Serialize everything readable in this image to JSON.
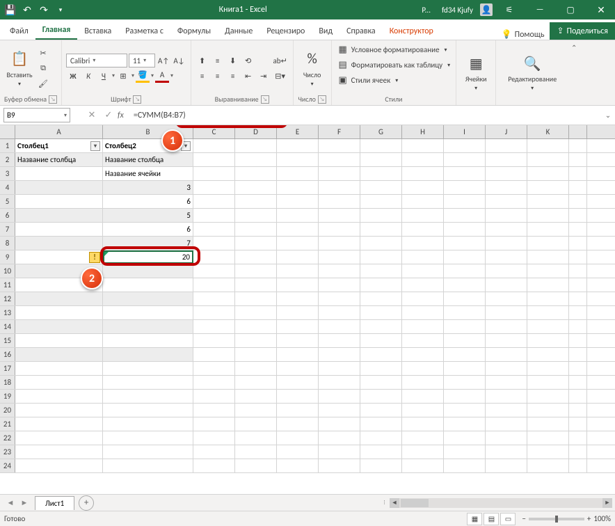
{
  "titlebar": {
    "title": "Книга1 - Excel",
    "user_initial": "P...",
    "user_name": "fd34 Kjufy"
  },
  "tabs": {
    "file": "Файл",
    "home": "Главная",
    "insert": "Вставка",
    "layout": "Разметка с",
    "formulas": "Формулы",
    "data": "Данные",
    "review": "Рецензиро",
    "view": "Вид",
    "help": "Справка",
    "constructor": "Конструктор",
    "help_btn": "Помощь",
    "share": "Поделиться"
  },
  "ribbon": {
    "clipboard": {
      "paste": "Вставить",
      "label": "Буфер обмена"
    },
    "font": {
      "name": "Calibri",
      "size": "11",
      "label": "Шрифт"
    },
    "align": {
      "label": "Выравнивание"
    },
    "number": {
      "btn": "Число",
      "label": "Число"
    },
    "styles": {
      "cond": "Условное форматирование",
      "table": "Форматировать как таблицу",
      "cell": "Стили ячеек",
      "label": "Стили"
    },
    "cells": {
      "btn": "Ячейки"
    },
    "editing": {
      "btn": "Редактирование"
    }
  },
  "namebox": "B9",
  "formula": "=СУММ(B4:B7)",
  "columns": [
    "A",
    "B",
    "C",
    "D",
    "E",
    "F",
    "G",
    "H",
    "I",
    "J",
    "K"
  ],
  "grid": {
    "a1": "Столбец1",
    "b1": "Столбец2",
    "a2": "Название столбца",
    "b2": "Название столбца",
    "b3": "Название ячейки",
    "b4": "3",
    "b5": "6",
    "b6": "5",
    "b7": "6",
    "b8": "7",
    "b9": "20"
  },
  "sheet": {
    "name": "Лист1"
  },
  "status": {
    "ready": "Готово",
    "zoom": "100%"
  },
  "badges": {
    "one": "1",
    "two": "2"
  }
}
